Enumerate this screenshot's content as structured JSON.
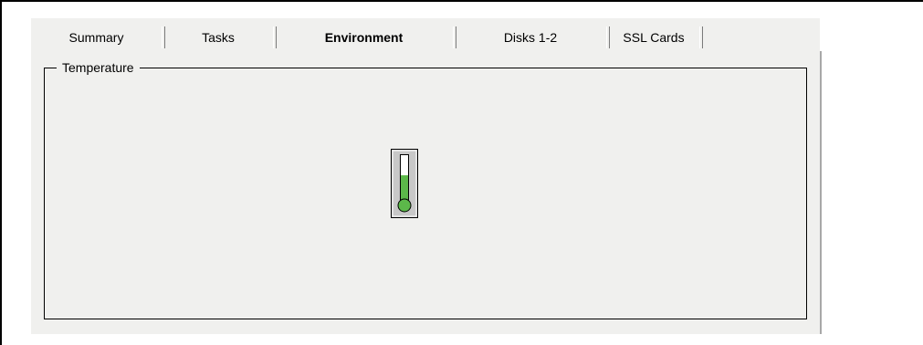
{
  "tabs": [
    {
      "label": "Summary",
      "active": false
    },
    {
      "label": "Tasks",
      "active": false
    },
    {
      "label": "Environment",
      "active": true
    },
    {
      "label": "Disks 1-2",
      "active": false
    },
    {
      "label": "SSL Cards",
      "active": false
    }
  ],
  "temperature_group": {
    "legend": "Temperature",
    "thermometer": {
      "icon": "thermometer-icon",
      "level": 0.55,
      "fill_color": "#5cb84a",
      "bulb_color": "#5cb84a"
    }
  }
}
